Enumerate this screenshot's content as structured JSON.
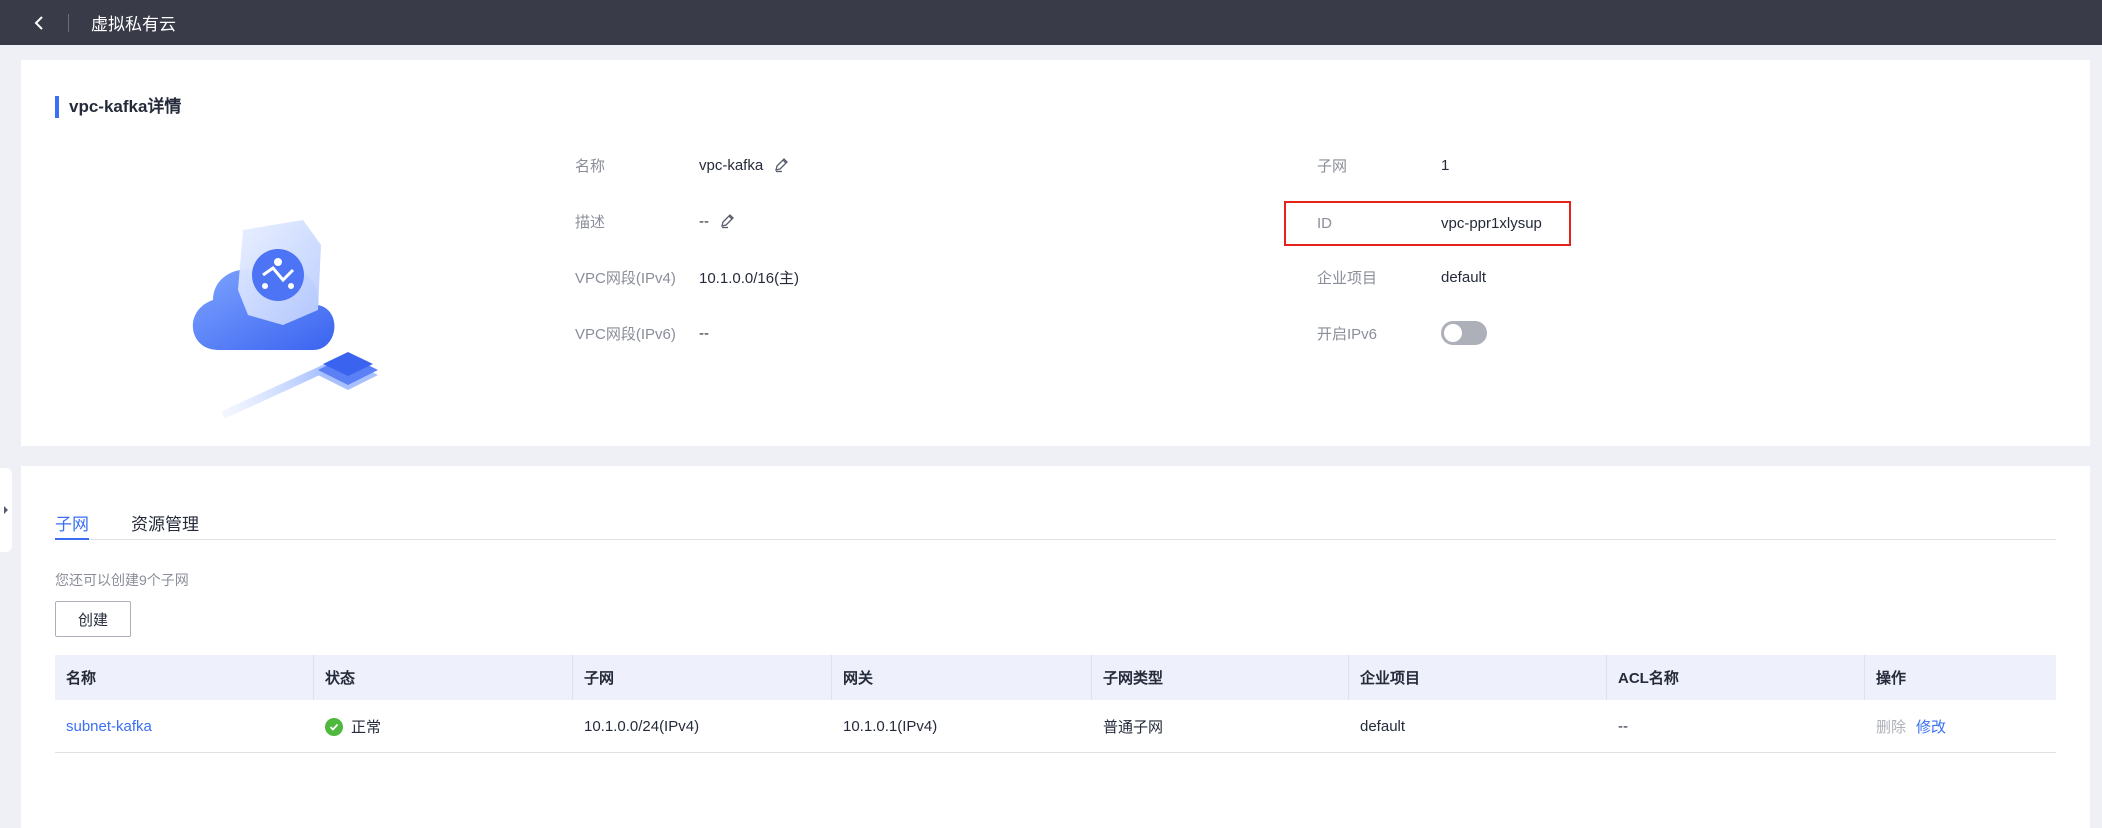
{
  "topbar": {
    "title": "虚拟私有云"
  },
  "detail": {
    "title": "vpc-kafka详情",
    "left_fields": [
      {
        "label": "名称",
        "value": "vpc-kafka"
      },
      {
        "label": "描述",
        "value": "--"
      },
      {
        "label": "VPC网段(IPv4)",
        "value": "10.1.0.0/16(主)"
      },
      {
        "label": "VPC网段(IPv6)",
        "value": "--"
      }
    ],
    "right_fields": [
      {
        "label": "子网",
        "value": "1"
      },
      {
        "label": "ID",
        "value": "vpc-ppr1xlysup"
      },
      {
        "label": "企业项目",
        "value": "default"
      },
      {
        "label": "开启IPv6",
        "value": ""
      }
    ],
    "ipv6_enabled": false
  },
  "subnets": {
    "tabs": [
      {
        "label": "子网"
      },
      {
        "label": "资源管理"
      }
    ],
    "hint": "您还可以创建9个子网",
    "create_label": "创建",
    "columns": [
      "名称",
      "状态",
      "子网",
      "网关",
      "子网类型",
      "企业项目",
      "ACL名称",
      "操作"
    ],
    "rows": [
      {
        "name": "subnet-kafka",
        "status": "正常",
        "cidr": "10.1.0.0/24(IPv4)",
        "gateway": "10.1.0.1(IPv4)",
        "type": "普通子网",
        "enterprise": "default",
        "acl": "--",
        "action_delete": "删除",
        "action_modify": "修改"
      }
    ]
  },
  "colors": {
    "accent": "#3a6ff5",
    "topbar": "#393c48",
    "highlight": "#e5231b",
    "status_ok": "#50b83c"
  }
}
